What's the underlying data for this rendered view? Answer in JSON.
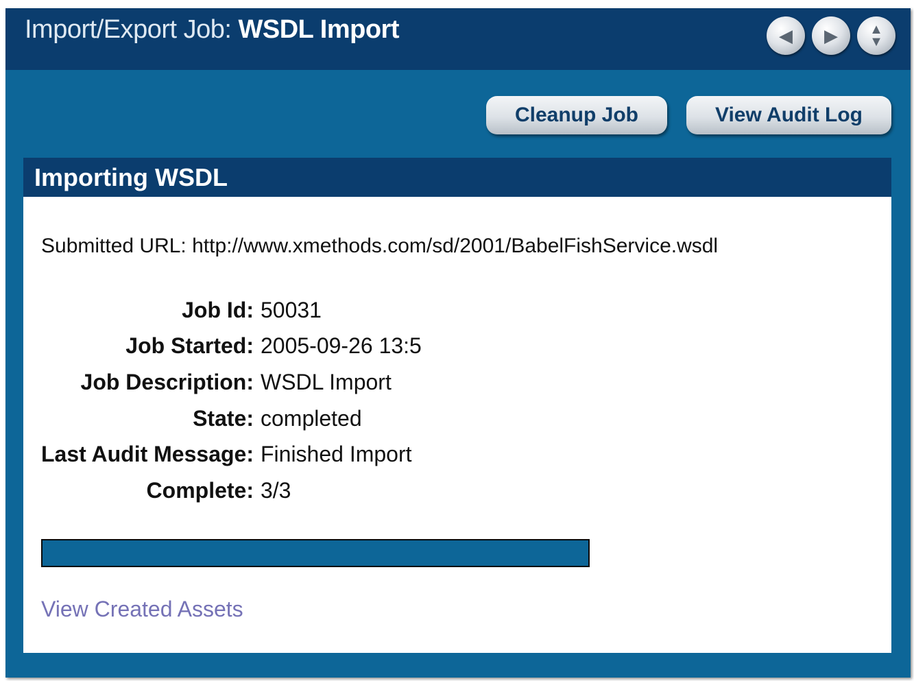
{
  "header": {
    "title_prefix": "Import/Export Job:",
    "title_name": "WSDL Import",
    "nav": {
      "back_icon": "◀",
      "forward_icon": "▶",
      "up_icon": "▲",
      "down_icon": "▼"
    }
  },
  "toolbar": {
    "cleanup_label": "Cleanup Job",
    "audit_label": "View Audit Log"
  },
  "panel": {
    "title": "Importing WSDL",
    "submitted_url": "Submitted URL: http://www.xmethods.com/sd/2001/BabelFishService.wsdl",
    "fields": [
      {
        "label": "Job Id:",
        "value": "50031"
      },
      {
        "label": "Job Started:",
        "value": "2005-09-26 13:5"
      },
      {
        "label": "Job Description:",
        "value": "WSDL Import"
      },
      {
        "label": "State:",
        "value": "completed"
      },
      {
        "label": "Last Audit Message:",
        "value": "Finished Import"
      },
      {
        "label": "Complete:",
        "value": "3/3"
      }
    ],
    "progress_fraction": 1.0,
    "view_assets_link": "View Created Assets"
  },
  "colors": {
    "dark_blue": "#0b3d6e",
    "mid_blue": "#0d6698",
    "link": "#7572b6"
  }
}
